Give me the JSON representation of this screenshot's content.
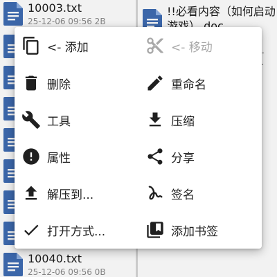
{
  "left_files": [
    {
      "name": "10003.txt",
      "meta": "25-12-06 09:56  2B"
    },
    {
      "name": "",
      "meta": ""
    },
    {
      "name": "",
      "meta": ""
    },
    {
      "name": "",
      "meta": ""
    },
    {
      "name": "",
      "meta": ""
    },
    {
      "name": "",
      "meta": ""
    },
    {
      "name": "",
      "meta": ""
    },
    {
      "name": "",
      "meta": ""
    },
    {
      "name": "10040.txt",
      "meta": "25-12-06 09:56  0B"
    }
  ],
  "right_files": [
    {
      "name": "!!必看内容（如何启动游戏）.doc"
    }
  ],
  "colors": {
    "file_icon": "#3f6cb3",
    "menu_icon": "#202020",
    "disabled": "#a8a8a8"
  },
  "menu": {
    "items": [
      {
        "label": "<- 添加",
        "icon": "copy-icon",
        "enabled": true
      },
      {
        "label": "<- 移动",
        "icon": "scissors-icon",
        "enabled": false
      },
      {
        "label": "删除",
        "icon": "trash-icon",
        "enabled": true
      },
      {
        "label": "重命名",
        "icon": "pencil-icon",
        "enabled": true
      },
      {
        "label": "工具",
        "icon": "wrench-icon",
        "enabled": true
      },
      {
        "label": "压缩",
        "icon": "download-icon",
        "enabled": true
      },
      {
        "label": "属性",
        "icon": "info-alert-icon",
        "enabled": true
      },
      {
        "label": "分享",
        "icon": "share-icon",
        "enabled": true
      },
      {
        "label": "解压到...",
        "icon": "upload-icon",
        "enabled": true
      },
      {
        "label": "签名",
        "icon": "signature-icon",
        "enabled": true
      },
      {
        "label": "打开方式...",
        "icon": "check-icon",
        "enabled": true
      },
      {
        "label": "添加书签",
        "icon": "bookmark-add-icon",
        "enabled": true
      }
    ]
  }
}
